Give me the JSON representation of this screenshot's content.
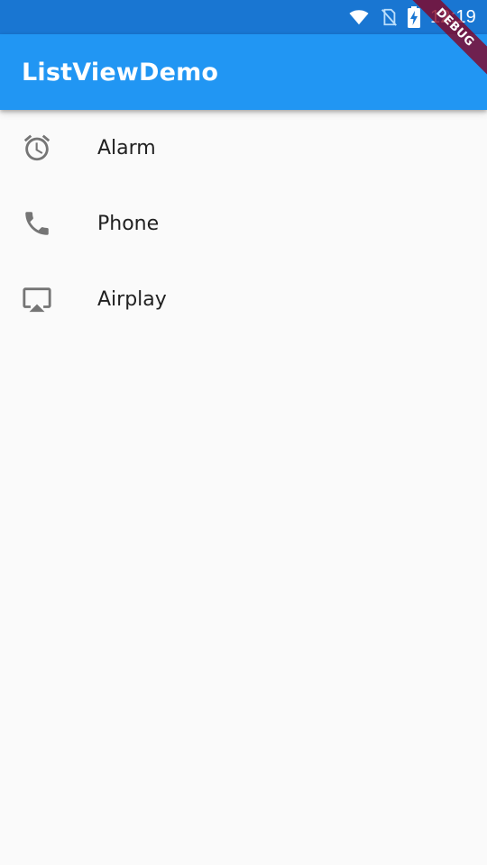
{
  "status_bar": {
    "time": "12:19",
    "icons": [
      "wifi-icon",
      "no-sim-icon",
      "battery-charging-icon"
    ],
    "background": "#1976d2"
  },
  "app_bar": {
    "title": "ListViewDemo",
    "background": "#2196f3"
  },
  "list": {
    "items": [
      {
        "icon": "alarm-icon",
        "label": "Alarm"
      },
      {
        "icon": "phone-icon",
        "label": "Phone"
      },
      {
        "icon": "airplay-icon",
        "label": "Airplay"
      }
    ],
    "icon_color": "#757575",
    "text_color": "#212121"
  },
  "debug_banner": {
    "label": "DEBUG",
    "color": "#850020"
  }
}
